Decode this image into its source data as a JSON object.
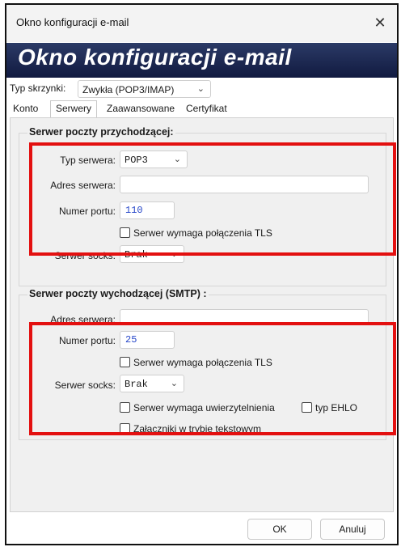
{
  "window": {
    "title": "Okno konfiguracji e-mail",
    "close_glyph": "✕"
  },
  "banner": {
    "text": "Okno konfiguracji e-mail"
  },
  "mailbox_type": {
    "label": "Typ skrzynki:",
    "value": "Zwykła (POP3/IMAP)"
  },
  "tabs": [
    "Konto",
    "Serwery",
    "Zaawansowane",
    "Certyfikat"
  ],
  "incoming": {
    "title": "Serwer poczty przychodzącej:",
    "server_type_label": "Typ serwera:",
    "server_type_value": "POP3",
    "address_label": "Adres serwera:",
    "address_value": "",
    "port_label": "Numer portu:",
    "port_value": "110",
    "tls_label": "Serwer wymaga połączenia TLS",
    "socks_label": "Serwer socks:",
    "socks_value": "Brak"
  },
  "outgoing": {
    "title": "Serwer poczty wychodzącej (SMTP) :",
    "address_label": "Adres serwera:",
    "address_value": "",
    "port_label": "Numer portu:",
    "port_value": "25",
    "tls_label": "Serwer wymaga połączenia TLS",
    "socks_label": "Serwer socks:",
    "socks_value": "Brak",
    "auth_label": "Serwer wymaga uwierzytelnienia",
    "ehlo_label": "typ EHLO",
    "attachments_label": "Załączniki w trybie tekstowym"
  },
  "buttons": {
    "ok": "OK",
    "cancel": "Anuluj"
  },
  "colors": {
    "highlight": "#e31010",
    "banner": "#1a2550",
    "value_text": "#2747c9"
  }
}
